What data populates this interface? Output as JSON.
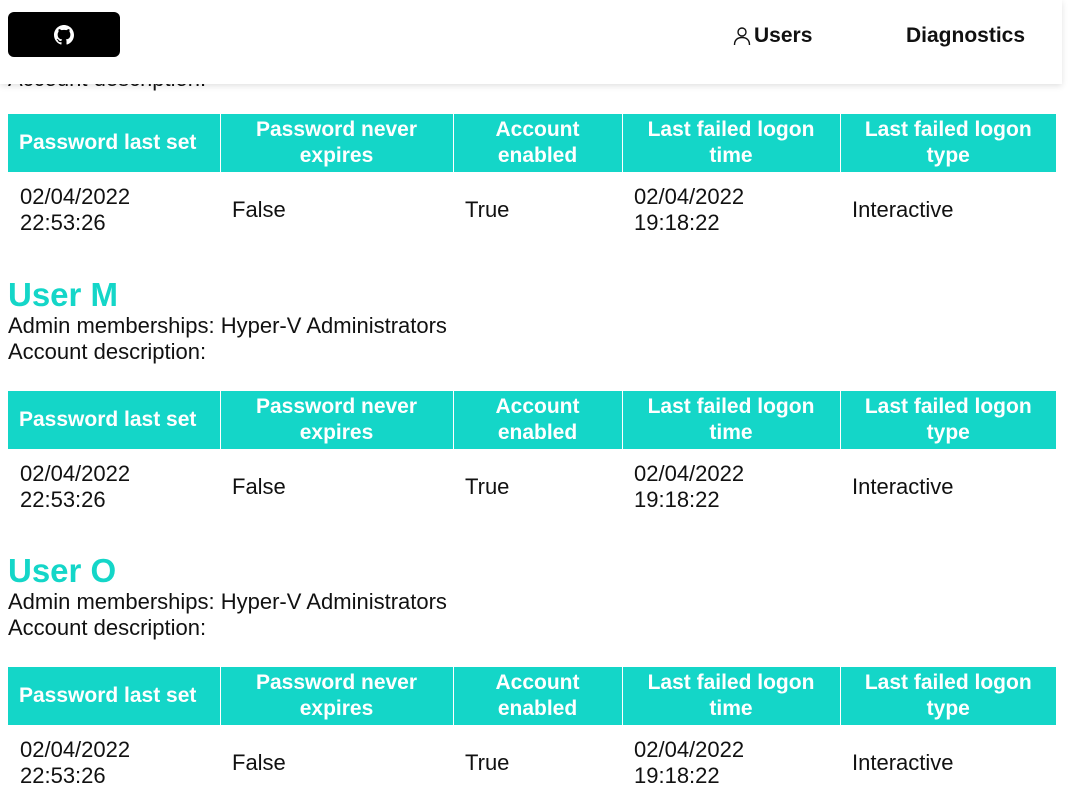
{
  "header": {
    "github_icon": "github-icon",
    "user_icon": "user-icon",
    "nav_users": "Users",
    "nav_diagnostics": "Diagnostics"
  },
  "peek_text": "Account description:",
  "table_headers": [
    "Password last set",
    "Password never expires",
    "Account enabled",
    "Last failed logon time",
    "Last failed logon type"
  ],
  "labels": {
    "admin_memberships": "Admin memberships: ",
    "account_description": "Account description:"
  },
  "sections": [
    {
      "rows": [
        [
          "02/04/2022 22:53:26",
          "False",
          "True",
          "02/04/2022 19:18:22",
          "Interactive"
        ]
      ]
    },
    {
      "name": "User M",
      "admin_memberships": "Hyper-V Administrators",
      "account_description": "",
      "rows": [
        [
          "02/04/2022 22:53:26",
          "False",
          "True",
          "02/04/2022 19:18:22",
          "Interactive"
        ]
      ]
    },
    {
      "name": "User O",
      "admin_memberships": "Hyper-V Administrators",
      "account_description": "",
      "rows": [
        [
          "02/04/2022 22:53:26",
          "False",
          "True",
          "02/04/2022 19:18:22",
          "Interactive"
        ]
      ]
    }
  ]
}
